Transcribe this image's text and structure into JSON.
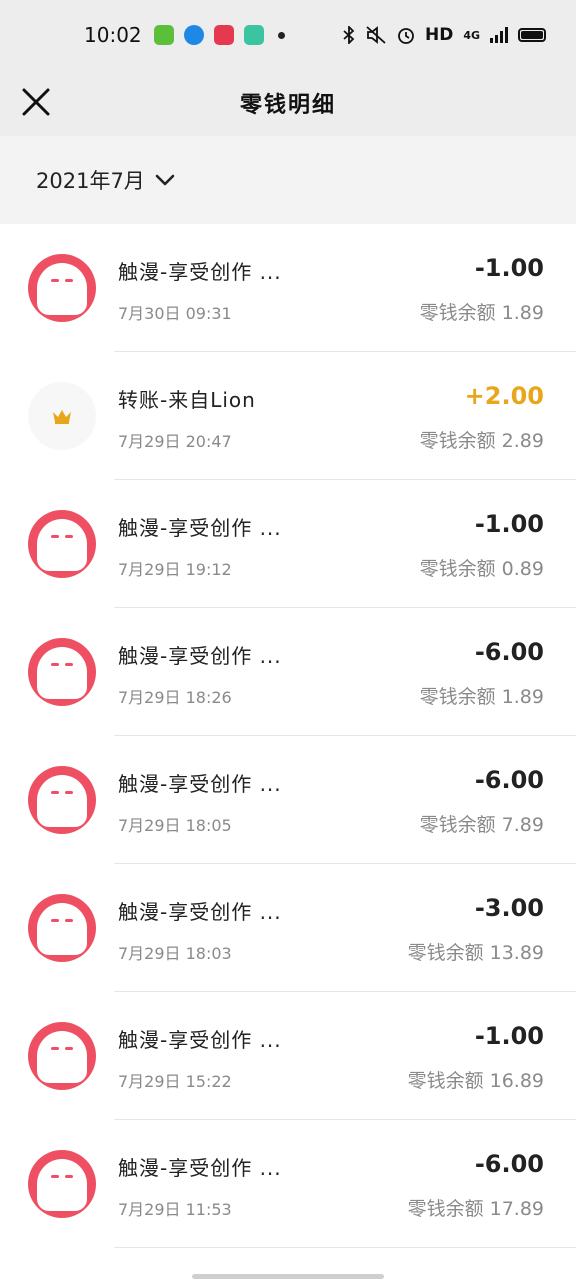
{
  "status_bar": {
    "time": "10:02",
    "network": "HD",
    "signal": "4G"
  },
  "nav": {
    "title": "零钱明细"
  },
  "filter": {
    "month": "2021年7月"
  },
  "transactions": [
    {
      "title": "触漫-享受创作 ...",
      "time": "7月30日 09:31",
      "amount": "-1.00",
      "balance": "零钱余额 1.89",
      "avatar": "chuman-ghost-icon"
    },
    {
      "title": "转账-来自Lion",
      "time": "7月29日 20:47",
      "amount": "+2.00",
      "balance": "零钱余额 2.89",
      "avatar": "crown-icon"
    },
    {
      "title": "触漫-享受创作 ...",
      "time": "7月29日 19:12",
      "amount": "-1.00",
      "balance": "零钱余额 0.89",
      "avatar": "chuman-ghost-icon"
    },
    {
      "title": "触漫-享受创作 ...",
      "time": "7月29日 18:26",
      "amount": "-6.00",
      "balance": "零钱余额 1.89",
      "avatar": "chuman-ghost-icon"
    },
    {
      "title": "触漫-享受创作 ...",
      "time": "7月29日 18:05",
      "amount": "-6.00",
      "balance": "零钱余额 7.89",
      "avatar": "chuman-ghost-icon"
    },
    {
      "title": "触漫-享受创作 ...",
      "time": "7月29日 18:03",
      "amount": "-3.00",
      "balance": "零钱余额 13.89",
      "avatar": "chuman-ghost-icon"
    },
    {
      "title": "触漫-享受创作 ...",
      "time": "7月29日 15:22",
      "amount": "-1.00",
      "balance": "零钱余额 16.89",
      "avatar": "chuman-ghost-icon"
    },
    {
      "title": "触漫-享受创作 ...",
      "time": "7月29日 11:53",
      "amount": "-6.00",
      "balance": "零钱余额 17.89",
      "avatar": "chuman-ghost-icon"
    }
  ],
  "colors": {
    "positive_amount": "#e8a71a",
    "avatar_pink": "#ef4f63",
    "header_bg": "#ededed"
  }
}
